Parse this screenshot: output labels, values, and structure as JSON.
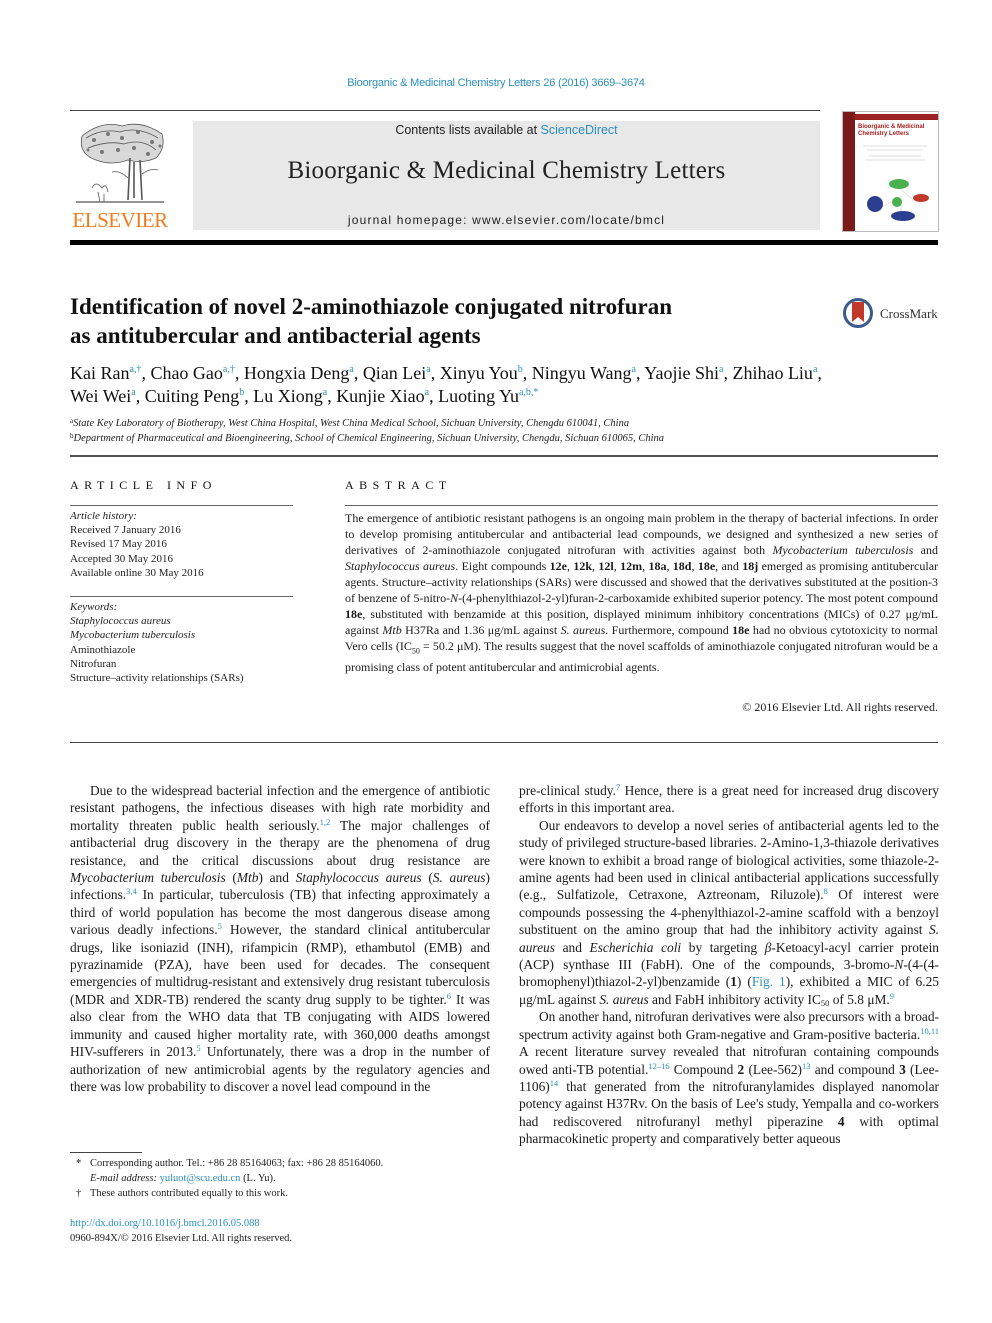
{
  "header": {
    "running_head": "Bioorganic & Medicinal Chemistry Letters 26 (2016) 3669–3674",
    "contents_prefix": "Contents lists available at ",
    "contents_link": "ScienceDirect",
    "journal_name": "Bioorganic & Medicinal Chemistry Letters",
    "homepage_prefix": "journal homepage: ",
    "homepage_url": "www.elsevier.com/locate/bmcl",
    "publisher_logo_text": "ELSEVIER",
    "cover_title_line1": "Bioorganic & Medicinal",
    "cover_title_line2": "Chemistry Letters",
    "crossmark_label": "CrossMark"
  },
  "article": {
    "title_line1": "Identification of novel 2-aminothiazole conjugated nitrofuran",
    "title_line2": "as antitubercular and antibacterial agents",
    "authors": [
      {
        "name": "Kai Ran",
        "sup": "a,†",
        "sep": ", "
      },
      {
        "name": "Chao Gao",
        "sup": "a,†",
        "sep": ", "
      },
      {
        "name": "Hongxia Deng",
        "sup": "a",
        "sep": ", "
      },
      {
        "name": "Qian Lei",
        "sup": "a",
        "sep": ", "
      },
      {
        "name": "Xinyu You",
        "sup": "b",
        "sep": ", "
      },
      {
        "name": "Ningyu Wang",
        "sup": "a",
        "sep": ", "
      },
      {
        "name": "Yaojie Shi",
        "sup": "a",
        "sep": ", "
      },
      {
        "name": "Zhihao Liu",
        "sup": "a",
        "sep": ","
      },
      {
        "name": "Wei Wei",
        "sup": "a",
        "sep": ", "
      },
      {
        "name": "Cuiting Peng",
        "sup": "b",
        "sep": ", "
      },
      {
        "name": "Lu Xiong",
        "sup": "a",
        "sep": ", "
      },
      {
        "name": "Kunjie Xiao",
        "sup": "a",
        "sep": ", "
      },
      {
        "name": "Luoting Yu",
        "sup": "a,b,*",
        "sep": ""
      }
    ],
    "affiliations": [
      {
        "mark": "a",
        "text": "State Key Laboratory of Biotherapy, West China Hospital, West China Medical School, Sichuan University, Chengdu 610041, China"
      },
      {
        "mark": "b",
        "text": "Department of Pharmaceutical and Bioengineering, School of Chemical Engineering, Sichuan University, Chengdu, Sichuan 610065, China"
      }
    ]
  },
  "article_info": {
    "heading": "ARTICLE INFO",
    "history_label": "Article history:",
    "history": [
      "Received 7 January 2016",
      "Revised 17 May 2016",
      "Accepted 30 May 2016",
      "Available online 30 May 2016"
    ],
    "keywords_label": "Keywords:",
    "keywords": [
      {
        "text": "Staphylococcus aureus",
        "italic": true
      },
      {
        "text": "Mycobacterium tuberculosis",
        "italic": true
      },
      {
        "text": "Aminothiazole",
        "italic": false
      },
      {
        "text": "Nitrofuran",
        "italic": false
      },
      {
        "text": "Structure–activity relationships (SARs)",
        "italic": false
      }
    ]
  },
  "abstract": {
    "heading": "ABSTRACT",
    "s1": "The emergence of antibiotic resistant pathogens is an ongoing main problem in the therapy of bacterial infections. In order to develop promising antitubercular and antibacterial lead compounds, we designed and synthesized a new series of derivatives of 2-aminothiazole conjugated nitrofuran with activities against both ",
    "mtb": "Mycobacterium tuberculosis",
    "and": " and ",
    "sa": "Staphylococcus aureus",
    "s2": ". Eight compounds ",
    "c1": "12e",
    "c2": "12k",
    "c3": "12l",
    "c4": "12m",
    "c5": "18a",
    "c6": "18d",
    "c7": "18e",
    "c8": "18j",
    "comma": ", ",
    "and2": ", and ",
    "s3": " emerged as promising antitubercular agents. Structure–activity relationships (SARs) were discussed and showed that the derivatives substituted at the position-3 of benzene of 5-nitro-",
    "n": "N",
    "s4": "-(4-phenylthiazol-2-yl)furan-2-carboxamide exhibited superior potency. The most potent compound ",
    "s5": ", substituted with benzamide at this position, displayed minimum inhibitory concentrations (MICs) of 0.27 μg/mL against ",
    "mtb_abbr": "Mtb",
    "s6": " H37Ra and 1.36 μg/mL against ",
    "saureus": "S. aureus",
    "s7": ". Furthermore, compound ",
    "s8": " had no obvious cytotoxicity to normal Vero cells (IC",
    "sub50": "50",
    "s9": " = 50.2 μM). The results suggest that the novel scaffolds of aminothiazole conjugated nitrofuran would be a promising class of potent antitubercular and antimicrobial agents.",
    "copyright": "© 2016 Elsevier Ltd. All rights reserved."
  },
  "body": {
    "left": {
      "p1a": "Due to the widespread bacterial infection and the emergence of antibiotic resistant pathogens, the infectious diseases with high rate morbidity and mortality threaten public health seriously.",
      "r1": "1,2",
      "p1b": " The major challenges of antibacterial drug discovery in the therapy are the phenomena of drug resistance, and the critical discussions about drug resistance are ",
      "mtb": "Mycobacterium tuberculosis",
      "p1c": " (",
      "mtb_abbr": "Mtb",
      "p1d": ") and ",
      "sa": "Staphylococcus aureus",
      "p1e": " (",
      "sa_abbr": "S. aureus",
      "p1f": ") infections.",
      "r2": "3,4",
      "p1g": " In particular, tuberculosis (TB) that infecting approximately a third of world population has become the most dangerous disease among various deadly infections.",
      "r3": "5",
      "p1h": " However, the standard clinical antitubercular drugs, like isoniazid (INH), rifampicin (RMP), ethambutol (EMB) and pyrazinamide (PZA), have been used for decades. The consequent emergencies of multidrug-resistant and extensively drug resistant tuberculosis (MDR and XDR-TB) rendered the scanty drug supply to be tighter.",
      "r4": "6",
      "p1i": " It was also clear from the WHO data that TB conjugating with AIDS lowered immunity and caused higher mortality rate, with 360,000 deaths amongst HIV-sufferers in 2013.",
      "r5": "5",
      "p1j": " Unfortunately, there was a drop in the number of authorization of new antimicrobial agents by the regulatory agencies and there was low probability to discover a novel lead compound in the"
    },
    "right": {
      "p0a": "pre-clinical study.",
      "r7": "7",
      "p0b": " Hence, there is a great need for increased drug discovery efforts in this important area.",
      "p2a": "Our endeavors to develop a novel series of antibacterial agents led to the study of privileged structure-based libraries. 2-Amino-1,3-thiazole derivatives were known to exhibit a broad range of biological activities, some thiazole-2-amine agents had been used in clinical antibacterial applications successfully (e.g., Sulfatizole, Cetraxone, Aztreonam, Riluzole).",
      "r8": "8",
      "p2b": " Of interest were compounds possessing the 4-phenylthiazol-2-amine scaffold with a benzoyl substituent on the amino group that had the inhibitory activity against ",
      "sa_abbr": "S. aureus",
      "p2c": " and ",
      "ecoli": "Escherichia coli",
      "p2d": " by targeting ",
      "beta": "β",
      "p2e": "-Ketoacyl-acyl carrier protein (ACP) synthase III (FabH). One of the compounds, 3-bromo-",
      "n": "N",
      "p2f": "-(4-(4-bromophenyl)thiazol-2-yl)benzamide (",
      "cmp1": "1",
      "p2g": ") (",
      "fig1": "Fig. 1",
      "p2h": "), exhibited a MIC of 6.25 μg/mL against ",
      "p2i": " and FabH inhibitory activity IC",
      "sub50": "50",
      "p2j": " of 5.8 μM.",
      "r9": "9",
      "p3a": "On another hand, nitrofuran derivatives were also precursors with a broad-spectrum activity against both Gram-negative and Gram-positive bacteria.",
      "r10": "10,11",
      "p3b": " A recent literature survey revealed that nitrofuran containing compounds owed anti-TB potential.",
      "r12": "12–16",
      "p3c": " Compound ",
      "cmp2": "2",
      "p3d": " (Lee-562)",
      "r13": "13",
      "p3e": " and compound ",
      "cmp3": "3",
      "p3f": " (Lee-1106)",
      "r14": "14",
      "p3g": " that generated from the nitrofuranylamides displayed nanomolar potency against H37Rv. On the basis of Lee's study, Yempalla and co-workers had rediscovered nitrofuranyl methyl piperazine ",
      "cmp4": "4",
      "p3h": " with optimal pharmacokinetic property and comparatively better aqueous"
    }
  },
  "footnotes": {
    "corr_mark": "*",
    "corr_text": "Corresponding author. Tel.: +86 28 85164063; fax: +86 28 85164060.",
    "email_label": "E-mail address: ",
    "email": "yuluot@scu.edu.cn",
    "email_suffix": " (L. Yu).",
    "equal_mark": "†",
    "equal_text": "These authors contributed equally to this work.",
    "doi": "http://dx.doi.org/10.1016/j.bmcl.2016.05.088",
    "issn": "0960-894X/© 2016 Elsevier Ltd. All rights reserved."
  },
  "colors": {
    "link": "#2a8fbd",
    "elsevier_orange": "#f47b20",
    "banner_gray": "#e8e8e8"
  }
}
